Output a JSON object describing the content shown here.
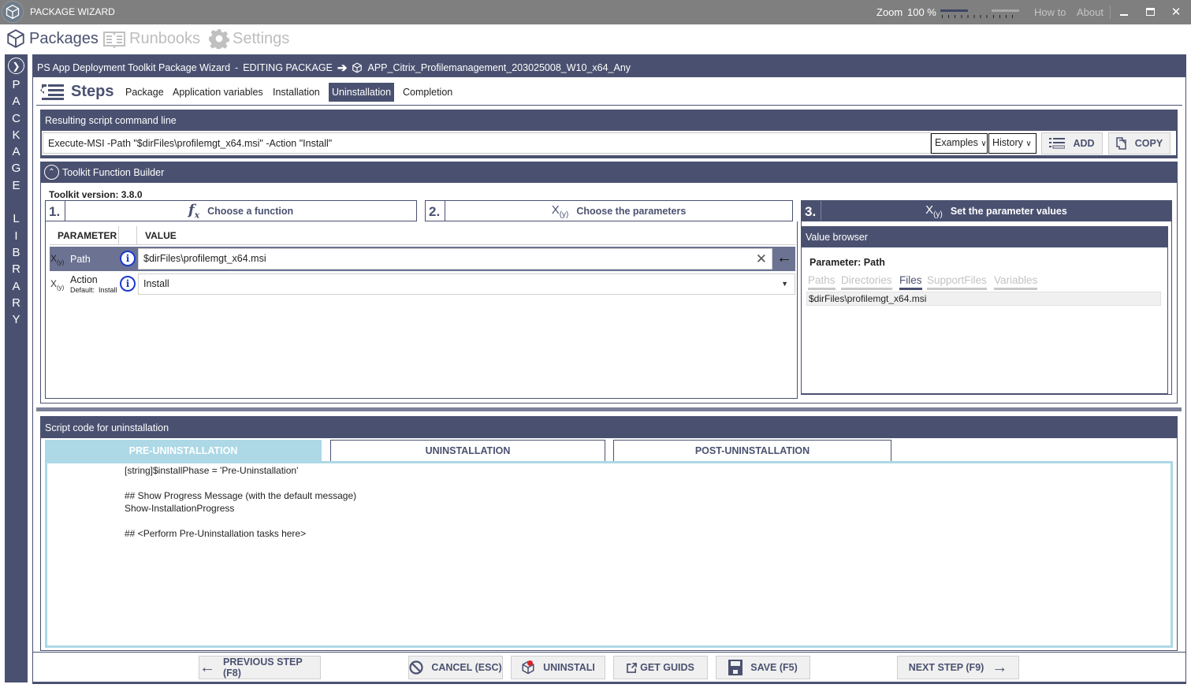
{
  "titlebar": {
    "app_title": "PACKAGE WIZARD",
    "zoom_label": "Zoom",
    "zoom_value": "100 %",
    "zoom_level_fraction": 0.5,
    "how_to": "How to",
    "about": "About",
    "minimize": "▁",
    "maximize": "□",
    "close": "✕"
  },
  "topnav": {
    "items": [
      {
        "label": "Packages",
        "icon": "cube-icon",
        "active": true
      },
      {
        "label": "Runbooks",
        "icon": "book-icon",
        "active": false
      },
      {
        "label": "Settings",
        "icon": "gear-icon",
        "active": false
      }
    ]
  },
  "library_bar": {
    "letters": [
      "P",
      "A",
      "C",
      "K",
      "A",
      "G",
      "E",
      "",
      "L",
      "I",
      "B",
      "R",
      "A",
      "R",
      "Y"
    ]
  },
  "package_header": {
    "wizard_title": "PS App Deployment Toolkit Package Wizard",
    "separator": "-",
    "mode": "EDITING PACKAGE",
    "package_name": "APP_Citrix_Profilemanagement_203025008_W10_x64_Any"
  },
  "steps": {
    "title": "Steps",
    "tabs": [
      {
        "label": "Package",
        "active": false
      },
      {
        "label": "Application variables",
        "active": false
      },
      {
        "label": "Installation",
        "active": false
      },
      {
        "label": "Uninstallation",
        "active": true
      },
      {
        "label": "Completion",
        "active": false
      }
    ]
  },
  "command": {
    "header": "Resulting script command line",
    "value": "Execute-MSI  -Path \"$dirFiles\\profilemgt_x64.msi\" -Action \"Install\"",
    "examples_label": "Examples",
    "history_label": "History",
    "add_label": "ADD",
    "copy_label": "COPY"
  },
  "builder": {
    "header": "Toolkit Function Builder",
    "version_label": "Toolkit version:",
    "version": "3.8.0",
    "steps": [
      {
        "num": "1.",
        "icon": "fx",
        "label": "Choose a function",
        "active": false
      },
      {
        "num": "2.",
        "icon": "X(y)",
        "label": "Choose the parameters",
        "active": false
      },
      {
        "num": "3.",
        "icon": "X(y)",
        "label": "Set the parameter values",
        "active": true
      }
    ],
    "grid": {
      "col_parameter": "PARAMETER",
      "col_value": "VALUE",
      "rows": [
        {
          "icon": "X(y)",
          "name": "Path",
          "default": "",
          "value": "$dirFiles\\profilemgt_x64.msi",
          "selected": true
        },
        {
          "icon": "X(y)",
          "name": "Action",
          "default": "Default:  Install",
          "value": "Install",
          "selected": false
        }
      ]
    },
    "value_browser": {
      "header": "Value browser",
      "parameter_label": "Parameter: Path",
      "tabs": [
        {
          "label": "Paths",
          "active": false
        },
        {
          "label": "Directories",
          "active": false
        },
        {
          "label": "Files",
          "active": true
        },
        {
          "label": "SupportFiles",
          "active": false
        },
        {
          "label": "Variables",
          "active": false
        }
      ],
      "items": [
        "$dirFiles\\profilemgt_x64.msi"
      ]
    }
  },
  "script": {
    "header": "Script code for uninstallation",
    "tabs": [
      {
        "label": "PRE-UNINSTALLATION",
        "active": true
      },
      {
        "label": "UNINSTALLATION",
        "active": false
      },
      {
        "label": "POST-UNINSTALLATION",
        "active": false
      }
    ],
    "code_lines": [
      "[string]$installPhase = 'Pre-Uninstallation'",
      "",
      "## Show Progress Message (with the default message)",
      "Show-InstallationProgress",
      "",
      "## <Perform Pre-Uninstallation tasks here>"
    ]
  },
  "bottom_buttons": {
    "previous": "PREVIOUS STEP (F8)",
    "cancel": "CANCEL (ESC)",
    "uninstall": "UNINSTALI",
    "get_guids": "GET GUIDS",
    "save": "SAVE (F5)",
    "next": "NEXT STEP (F9)"
  },
  "colors": {
    "primary": "#4a5170",
    "titlebar": "#7f7f7f",
    "active_code_tab": "#add8e6",
    "info_icon": "#1a3ad1"
  }
}
